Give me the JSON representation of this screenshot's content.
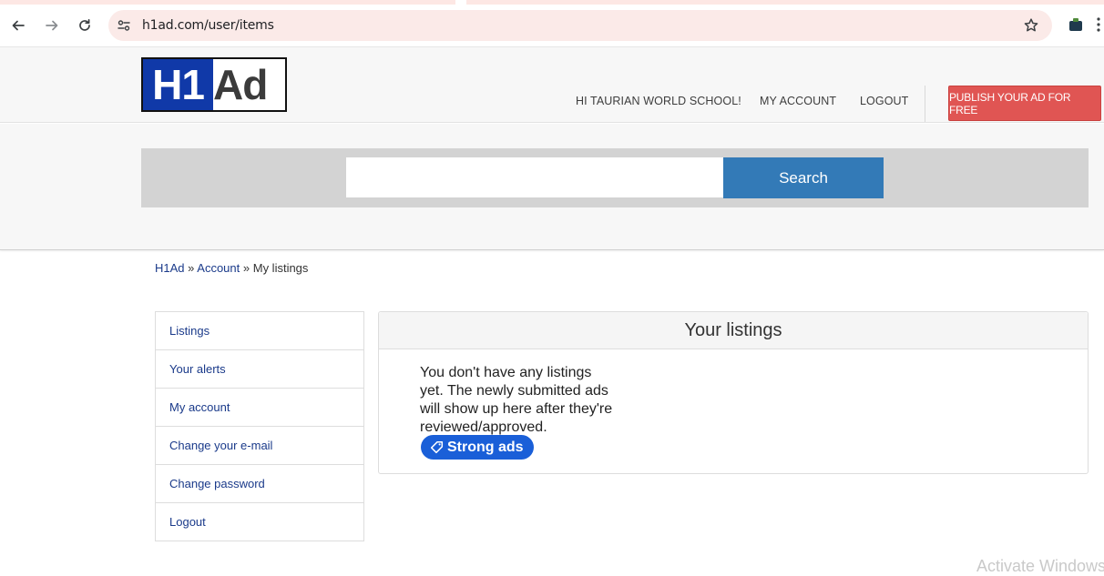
{
  "browser": {
    "url": "h1ad.com/user/items",
    "icons": [
      "back-arrow-icon",
      "forward-arrow-icon",
      "reload-icon",
      "site-settings-icon",
      "bookmark-star-icon",
      "extension-icon",
      "menu-kebab-icon"
    ]
  },
  "header": {
    "logo": {
      "part1": "H1",
      "part2": "Ad"
    },
    "nav": {
      "greeting": "HI TAURIAN WORLD SCHOOL!",
      "my_account": "MY ACCOUNT",
      "logout": "LOGOUT"
    },
    "publish_label": "PUBLISH YOUR AD FOR FREE"
  },
  "search": {
    "value": "",
    "placeholder": "",
    "button_label": "Search"
  },
  "breadcrumb": {
    "home": "H1Ad",
    "sep1": " » ",
    "account": "Account",
    "sep2": " » ",
    "current": "My listings"
  },
  "sidebar": {
    "items": [
      {
        "label": "Listings"
      },
      {
        "label": "Your alerts"
      },
      {
        "label": "My account"
      },
      {
        "label": "Change your e-mail"
      },
      {
        "label": "Change password"
      },
      {
        "label": "Logout"
      }
    ]
  },
  "listings": {
    "title": "Your listings",
    "empty_message": "You don't have any listings yet. The newly submitted ads will show up here after they're reviewed/approved.",
    "strong_ads_label": "Strong ads"
  },
  "colors": {
    "logo_blue": "#1039a8",
    "publish_red": "#e05553",
    "search_blue": "#337ab7",
    "link_blue": "#1a3a8a",
    "badge_blue": "#1a5fd8"
  },
  "watermark": "Activate Windows"
}
